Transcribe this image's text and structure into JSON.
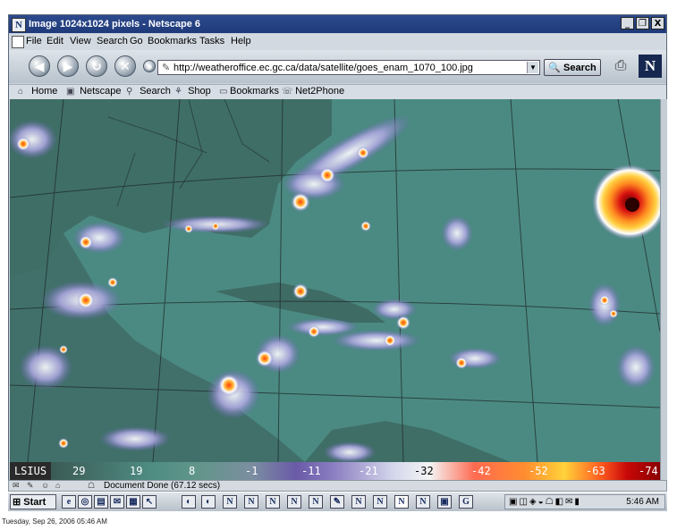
{
  "window": {
    "title": "Image 1024x1024 pixels - Netscape 6",
    "logo": "N",
    "controls": [
      "_",
      "❐",
      "X"
    ]
  },
  "menubar": {
    "items": [
      "File",
      "Edit",
      "View",
      "Search",
      "Go",
      "Bookmarks",
      "Tasks",
      "Help"
    ]
  },
  "navbar": {
    "url": "http://weatheroffice.ec.gc.ca/data/satellite/goes_enam_1070_100.jpg",
    "search_label": "Search",
    "back_icon": "back-icon",
    "forward_icon": "forward-icon",
    "reload_icon": "reload-icon",
    "stop_icon": "stop-icon",
    "n_logo": "N"
  },
  "personal_toolbar": {
    "items": [
      "Home",
      "Netscape",
      "Search",
      "Shop",
      "Bookmarks",
      "Net2Phone"
    ]
  },
  "colorbar": {
    "label": "LSIUS",
    "ticks": [
      "29",
      "19",
      "8",
      "-1",
      "-11",
      "-21",
      "-32",
      "-42",
      "-52",
      "-63",
      "-74"
    ]
  },
  "status": {
    "text": "Document Done (67.12 secs)"
  },
  "taskbar": {
    "start_label": "Start",
    "clock": "5:46 AM"
  },
  "datestamp": "Tuesday, Sep 26, 2006 05:46 AM"
}
